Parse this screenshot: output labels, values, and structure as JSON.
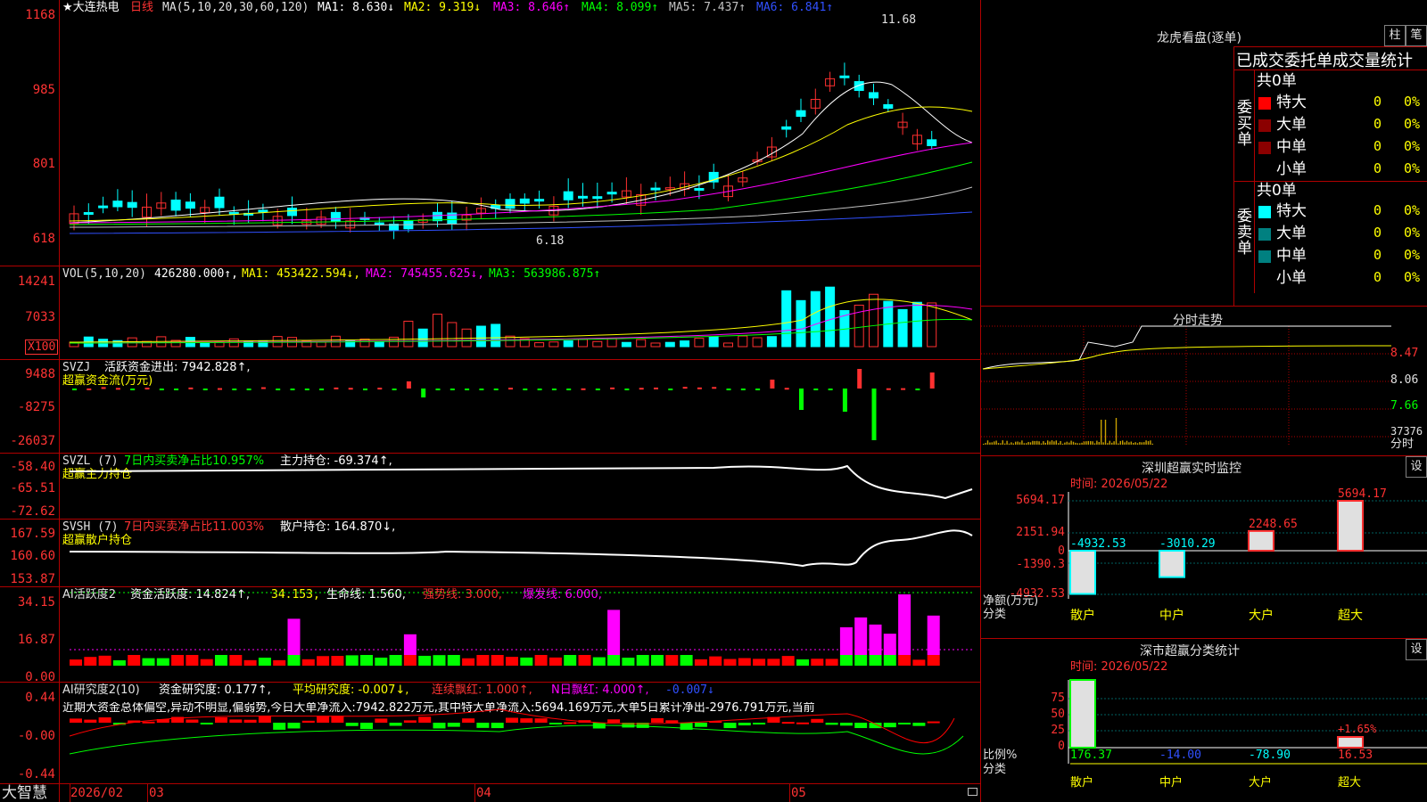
{
  "stock": {
    "title": "★大连热电",
    "period": "日线",
    "ma_label": "MA(5,10,20,30,60,120)",
    "ma1": "MA1: 8.630↓",
    "ma2": "MA2: 9.319↓",
    "ma3": "MA3: 8.646↑",
    "ma4": "MA4: 8.099↑",
    "ma5": "MA5: 7.437↑",
    "ma6": "MA6: 6.841↑",
    "high_mark": "11.68",
    "low_mark": "6.18",
    "axis": [
      "1168",
      "985",
      "801",
      "618"
    ]
  },
  "vol": {
    "label": "VOL(5,10,20)",
    "value": "426280.000↑,",
    "ma1": "MA1: 453422.594↓,",
    "ma2": "MA2: 745455.625↓,",
    "ma3": "MA3: 563986.875↑",
    "axis": [
      "14241",
      "7033"
    ],
    "unit": "X100"
  },
  "svzj": {
    "label": "SVZJ",
    "line1": "活跃资金进出: 7942.828↑,",
    "line2": "超赢资金流(万元)",
    "axis": [
      "9488",
      "-8275",
      "-26037"
    ]
  },
  "svzl": {
    "label": "SVZL (7)",
    "ratio": "7日内买卖净占比10.957%",
    "hold": "主力持仓: -69.374↑,",
    "line2": "超赢主力持仓",
    "axis": [
      "-58.40",
      "-65.51",
      "-72.62"
    ]
  },
  "svsh": {
    "label": "SVSH (7)",
    "ratio": "7日内买卖净占比11.003%",
    "hold": "散户持仓: 164.870↓,",
    "line2": "超赢散户持仓",
    "axis": [
      "167.59",
      "160.60",
      "153.87"
    ]
  },
  "ai2": {
    "label": "AI活跃度2",
    "active": "资金活跃度: 14.824↑,",
    "v2": "34.153,",
    "life": "生命线: 1.560,",
    "strong": "强势线: 3.000,",
    "burst": "爆发线: 6.000,",
    "axis": [
      "34.15",
      "16.87",
      "0.00"
    ]
  },
  "ai_research": {
    "label": "AI研究度2(10)",
    "research": "资金研究度: 0.177↑,",
    "avg": "平均研究度: -0.007↓,",
    "red": "连续飘红: 1.000↑,",
    "nday": "N日飘红: 4.000↑,",
    "last": "-0.007↓",
    "summary": "近期大资金总体偏空,异动不明显,偏弱势,今日大单净流入:7942.822万元,其中特大单净流入:5694.169万元,大单5日累计净出-2976.791万元,当前",
    "axis": [
      "0.44",
      "-0.00",
      "-0.44"
    ]
  },
  "bottom": {
    "brand": "大智慧",
    "dates": [
      "2026/02",
      "03",
      "04",
      "05"
    ]
  },
  "right": {
    "dragon_title": "龙虎看盘(逐单)",
    "btn_bar": "柱",
    "btn_pen": "笔",
    "tabs": "已成交委托单成交量统计",
    "buy_header": "共0单",
    "buy_label": "委买单",
    "buy_rows": [
      {
        "name": "特大",
        "n": "0",
        "p": "0%",
        "color": "#ff0000"
      },
      {
        "name": "大单",
        "n": "0",
        "p": "0%",
        "color": "#8b0000"
      },
      {
        "name": "中单",
        "n": "0",
        "p": "0%",
        "color": "#8b0000"
      },
      {
        "name": "小单",
        "n": "0",
        "p": "0%",
        "color": "#000000"
      }
    ],
    "sell_header": "共0单",
    "sell_label": "委卖单",
    "sell_rows": [
      {
        "name": "特大",
        "n": "0",
        "p": "0%",
        "color": "#00ffff"
      },
      {
        "name": "大单",
        "n": "0",
        "p": "0%",
        "color": "#008080"
      },
      {
        "name": "中单",
        "n": "0",
        "p": "0%",
        "color": "#008080"
      },
      {
        "name": "小单",
        "n": "0",
        "p": "0%",
        "color": "#000000"
      }
    ],
    "intraday_title": "分时走势",
    "intraday_axis": [
      "8.47",
      "8.06",
      "7.66",
      "37376",
      "分时"
    ],
    "monitor_title": "深圳超赢实时监控",
    "monitor_btn": "设",
    "monitor_time": "时间: 2026/05/22",
    "monitor_axis": [
      "5694.17",
      "2151.94",
      "0",
      "-1390.3",
      "-4932.53"
    ],
    "monitor_unit": "净额(万元)",
    "monitor_class": "分类",
    "monitor_bars": [
      {
        "label": "散户",
        "value": -4932.53,
        "text": "-4932.53"
      },
      {
        "label": "中户",
        "value": -3010.29,
        "text": "-3010.29"
      },
      {
        "label": "大户",
        "value": 2248.65,
        "text": "2248.65"
      },
      {
        "label": "超大",
        "value": 5694.17,
        "text": "5694.17"
      }
    ],
    "stat_title": "深市超赢分类统计",
    "stat_btn": "设",
    "stat_time": "时间: 2026/05/22",
    "stat_axis": [
      "75",
      "50",
      "25",
      "0"
    ],
    "stat_unit": "比例%",
    "stat_class": "分类",
    "stat_values": [
      "176.37",
      "-14.00",
      "-78.90",
      "16.53"
    ],
    "stat_note": "+1.65%",
    "stat_labels": [
      "散户",
      "中户",
      "大户",
      "超大"
    ]
  }
}
